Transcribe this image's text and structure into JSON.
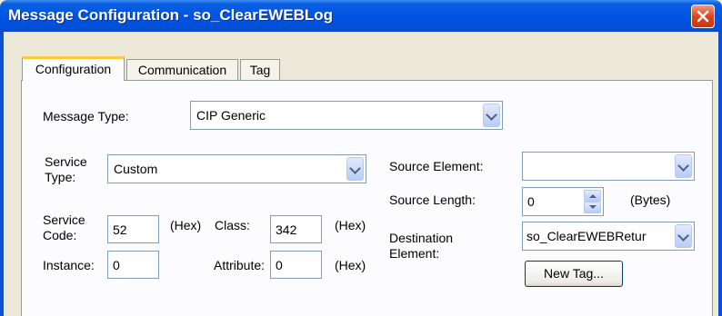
{
  "window": {
    "title": "Message Configuration - so_ClearEWEBLog",
    "close_icon": "close-icon"
  },
  "tabs": [
    {
      "label": "Configuration",
      "active": true
    },
    {
      "label": "Communication",
      "active": false
    },
    {
      "label": "Tag",
      "active": false
    }
  ],
  "form": {
    "message_type": {
      "label": "Message Type:",
      "value": "CIP Generic"
    },
    "service_type": {
      "label_line1": "Service",
      "label_line2": "Type:",
      "value": "Custom"
    },
    "service_code": {
      "label_line1": "Service",
      "label_line2": "Code:",
      "value": "52",
      "unit": "(Hex)"
    },
    "class": {
      "label": "Class:",
      "value": "342",
      "unit": "(Hex)"
    },
    "instance": {
      "label": "Instance:",
      "value": "0"
    },
    "attribute": {
      "label": "Attribute:",
      "value": "0",
      "unit": "(Hex)"
    },
    "source_element": {
      "label": "Source Element:",
      "value": ""
    },
    "source_length": {
      "label": "Source Length:",
      "value": "0",
      "unit": "(Bytes)"
    },
    "destination_element": {
      "label_line1": "Destination",
      "label_line2": "Element:",
      "value": "so_ClearEWEBRetur"
    },
    "new_tag_button": "New Tag..."
  },
  "colors": {
    "titlebar": "#0054E3",
    "close_button": "#E0441E",
    "active_tab_accent": "#FFC73C",
    "window_background": "#ECE9D8",
    "panel_background": "#FCFCFE"
  }
}
